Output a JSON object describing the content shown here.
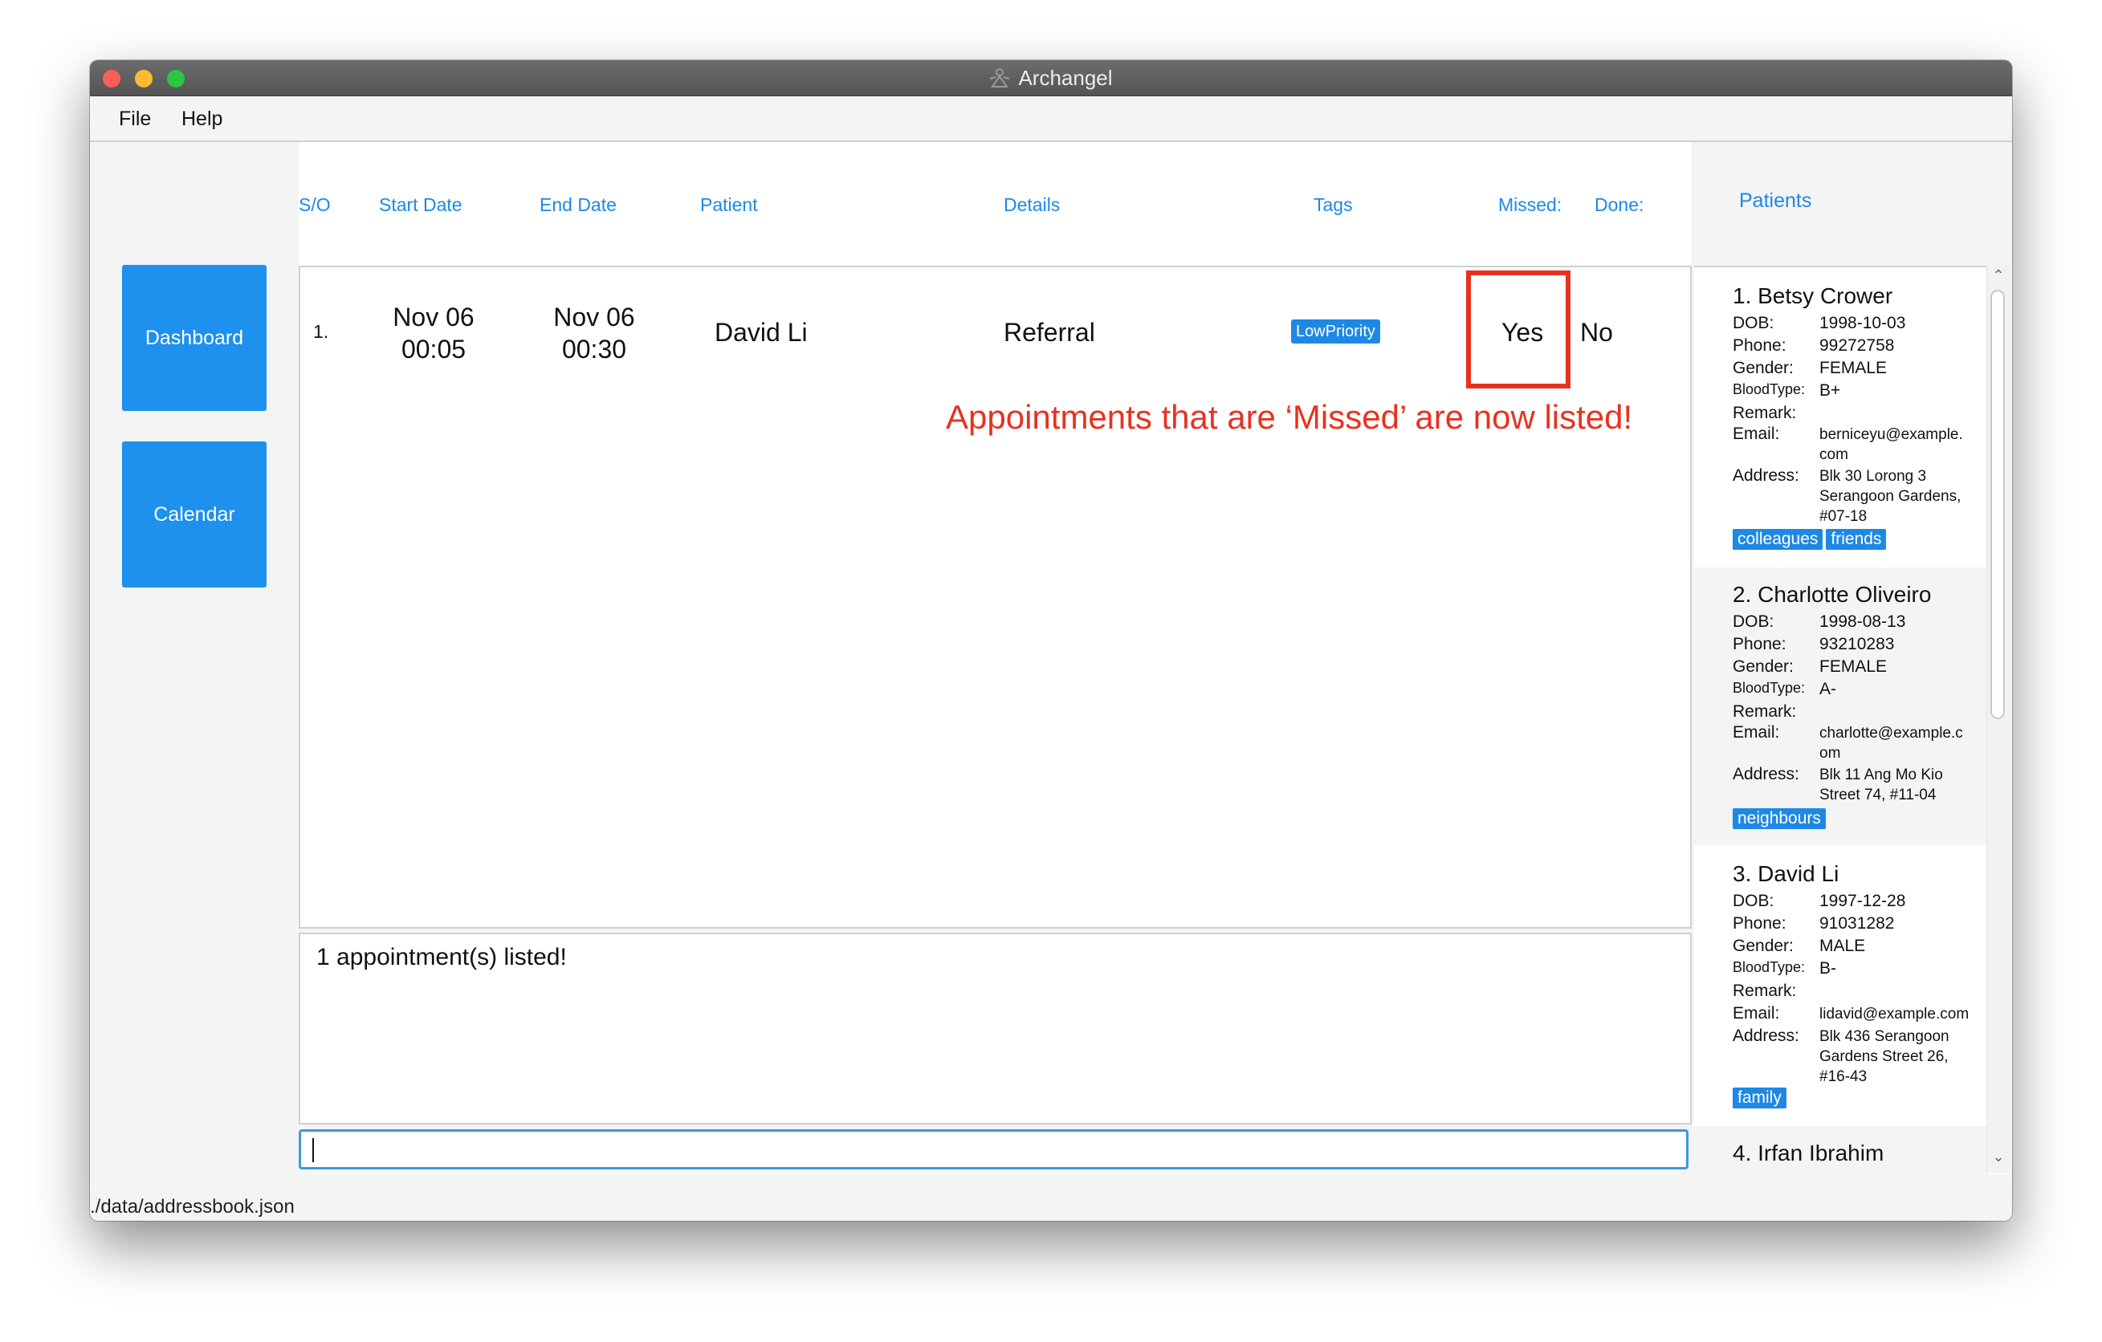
{
  "window": {
    "title": "Archangel"
  },
  "menu": [
    "File",
    "Help"
  ],
  "nav": {
    "dashboard": "Dashboard",
    "calendar": "Calendar"
  },
  "columns": {
    "so": "S/O",
    "start_date": "Start Date",
    "end_date": "End Date",
    "patient": "Patient",
    "details": "Details",
    "tags": "Tags",
    "missed": "Missed:",
    "done": "Done:"
  },
  "appointments": [
    {
      "index": "1.",
      "start_date": "Nov 06",
      "start_time": "00:05",
      "end_date": "Nov 06",
      "end_time": "00:30",
      "patient": "David Li",
      "details": "Referral",
      "tag": "LowPriority",
      "missed": "Yes",
      "done": "No"
    }
  ],
  "annotation": "Appointments that are ‘Missed’ are now listed!",
  "result_message": "1 appointment(s) listed!",
  "command_input": "",
  "status_path": "./data/addressbook.json",
  "patients_title": "Patients",
  "labels": {
    "dob": "DOB:",
    "phone": "Phone:",
    "gender": "Gender:",
    "bloodtype": "BloodType:",
    "remark": "Remark:",
    "email": "Email:",
    "address": "Address:"
  },
  "patients": [
    {
      "name": "1. Betsy Crower",
      "dob": "1998-10-03",
      "phone": "99272758",
      "gender": "FEMALE",
      "bloodtype": "B+",
      "remark": "",
      "email_1": "berniceyu@example.",
      "email_2": "com",
      "address_1": "Blk 30 Lorong 3",
      "address_2": "Serangoon Gardens,",
      "address_3": "#07-18",
      "tags": [
        "colleagues",
        "friends"
      ]
    },
    {
      "name": "2. Charlotte Oliveiro",
      "dob": "1998-08-13",
      "phone": "93210283",
      "gender": "FEMALE",
      "bloodtype": "A-",
      "remark": "",
      "email_1": "charlotte@example.c",
      "email_2": "om",
      "address_1": "Blk 11 Ang Mo Kio",
      "address_2": "Street 74, #11-04",
      "tags": [
        "neighbours"
      ]
    },
    {
      "name": "3. David Li",
      "dob": "1997-12-28",
      "phone": "91031282",
      "gender": "MALE",
      "bloodtype": "B-",
      "remark": "",
      "email_1": "lidavid@example.com",
      "address_1": "Blk 436 Serangoon",
      "address_2": "Gardens Street 26,",
      "address_3": "#16-43",
      "tags": [
        "family"
      ]
    },
    {
      "name": "4. Irfan Ibrahim"
    }
  ],
  "colors": {
    "accent": "#1e88e5",
    "nav_button": "#1e90ee",
    "highlight": "#e8321f"
  }
}
